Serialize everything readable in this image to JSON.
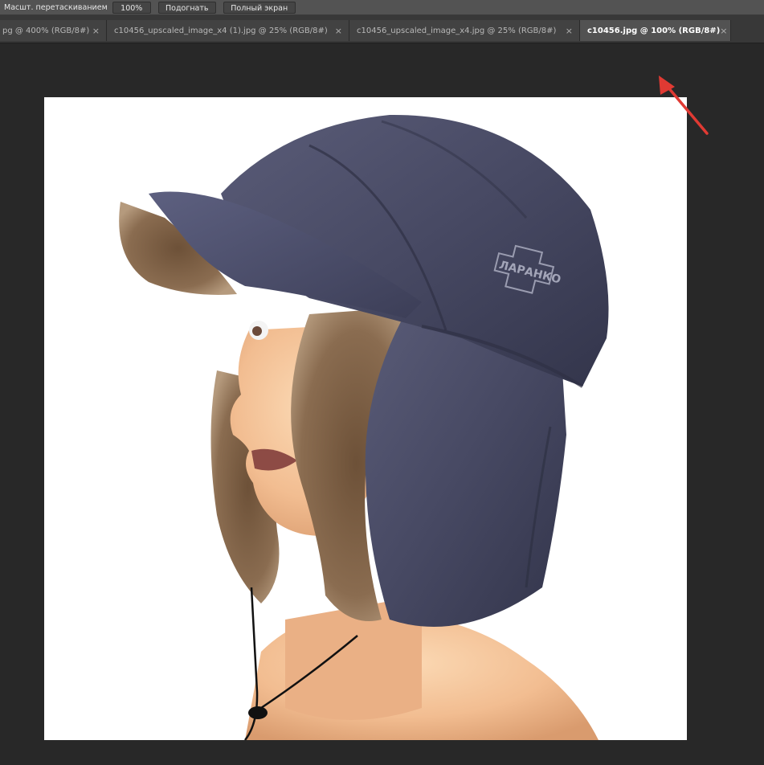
{
  "options_bar": {
    "scrubby_zoom_label": "Масшт. перетаскиванием",
    "btn_100_label": "100%",
    "btn_fit_label": "Подогнать",
    "btn_full_label": "Полный экран"
  },
  "tabs": [
    {
      "label": "pg @ 400% (RGB/8#)",
      "close": "×",
      "active": false
    },
    {
      "label": "c10456_upscaled_image_x4 (1).jpg @ 25% (RGB/8#)",
      "close": "×",
      "active": false
    },
    {
      "label": "c10456_upscaled_image_x4.jpg @ 25% (RGB/8#)",
      "close": "×",
      "active": false
    },
    {
      "label": "c10456.jpg @ 100% (RGB/8#)",
      "close": "×",
      "active": true
    }
  ],
  "document": {
    "logo_text": "ЛАРАНКО"
  },
  "colors": {
    "annotation_arrow": "#e03a33",
    "hat_fabric": "#4b4d66",
    "fur": "#8b6e52"
  }
}
